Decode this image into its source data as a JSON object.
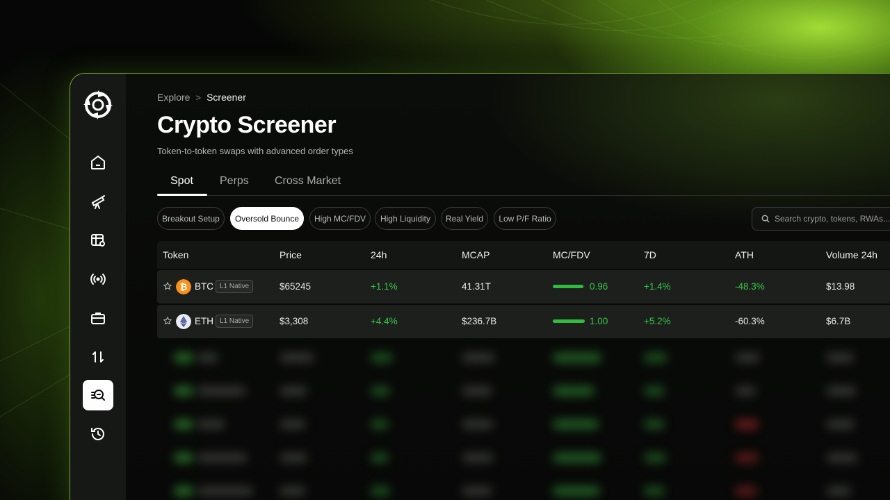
{
  "breadcrumb": {
    "root": "Explore",
    "separator": ">",
    "current": "Screener"
  },
  "page": {
    "title": "Crypto Screener",
    "subtitle": "Token-to-token swaps with advanced order types"
  },
  "tabs": [
    {
      "label": "Spot",
      "active": true
    },
    {
      "label": "Perps",
      "active": false
    },
    {
      "label": "Cross Market",
      "active": false
    }
  ],
  "filters": [
    {
      "label": "Breakout Setup",
      "active": false
    },
    {
      "label": "Oversold Bounce",
      "active": true
    },
    {
      "label": "High MC/FDV",
      "active": false
    },
    {
      "label": "High Liquidity",
      "active": false
    },
    {
      "label": "Real Yield",
      "active": false
    },
    {
      "label": "Low P/F Ratio",
      "active": false
    }
  ],
  "search": {
    "placeholder": "Search crypto, tokens, RWAs..."
  },
  "sidebar": {
    "items": [
      {
        "icon": "home-icon",
        "active": false
      },
      {
        "icon": "telescope-icon",
        "active": false
      },
      {
        "icon": "table-settings-icon",
        "active": false
      },
      {
        "icon": "broadcast-icon",
        "active": false
      },
      {
        "icon": "briefcase-icon",
        "active": false
      },
      {
        "icon": "swap-icon",
        "active": false
      },
      {
        "icon": "screener-icon",
        "active": true
      },
      {
        "icon": "history-icon",
        "active": false
      }
    ]
  },
  "table": {
    "columns": [
      "Token",
      "Price",
      "24h",
      "MCAP",
      "MC/FDV",
      "7D",
      "ATH",
      "Volume 24h"
    ],
    "rows": [
      {
        "symbol": "BTC",
        "tag": "L1 Native",
        "coin_color": "#f7931a",
        "coin_icon": "bitcoin-icon",
        "price": "$65245",
        "change_24h": "+1.1%",
        "mcap": "41.31T",
        "mc_fdv": "0.96",
        "mc_fdv_fraction": 0.96,
        "change_7d": "+1.4%",
        "ath": "-48.3%",
        "volume_24h": "$13.98",
        "ath_positive": true
      },
      {
        "symbol": "ETH",
        "tag": "L1 Native",
        "coin_color": "#e9ecf5",
        "coin_icon": "ethereum-icon",
        "price": "$3,308",
        "change_24h": "+4.4%",
        "mcap": "$236.7B",
        "mc_fdv": "1.00",
        "mc_fdv_fraction": 1.0,
        "change_7d": "+5.2%",
        "ath": "-60.3%",
        "volume_24h": "$6.7B",
        "ath_positive": false
      }
    ]
  },
  "colors": {
    "accent_green": "#35c64a",
    "brand_lime": "#a8e638",
    "active_white": "#ffffff"
  }
}
